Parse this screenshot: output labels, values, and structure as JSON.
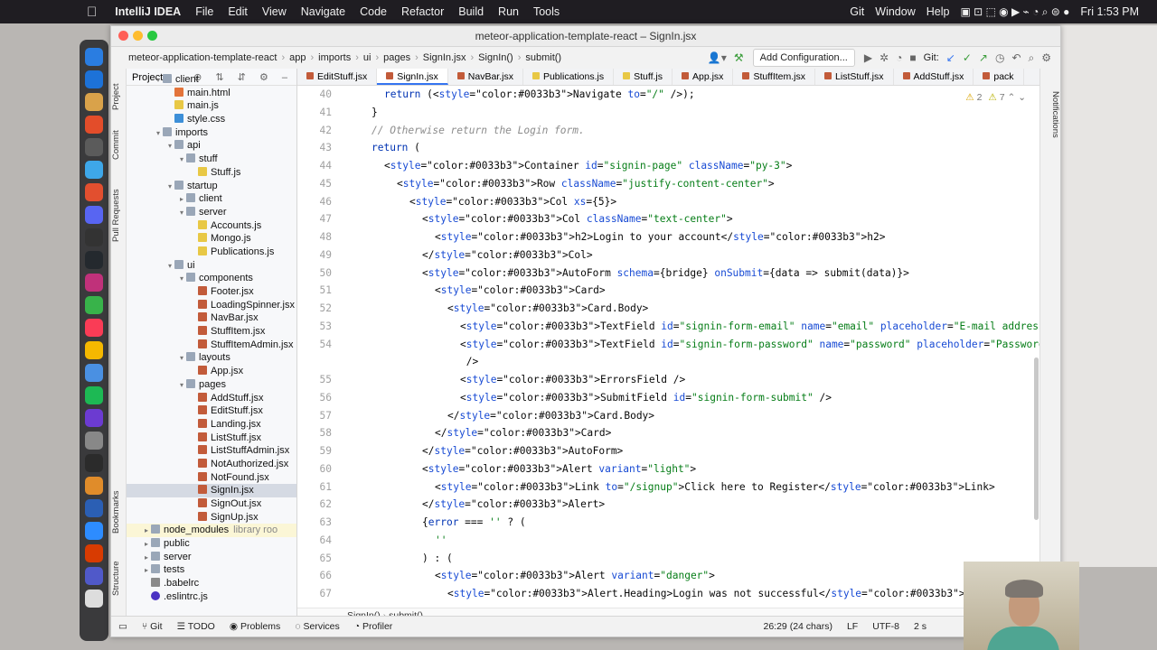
{
  "menubar": {
    "app": "IntelliJ IDEA",
    "items": [
      "File",
      "Edit",
      "View",
      "Navigate",
      "Code",
      "Refactor",
      "Build",
      "Run",
      "Tools"
    ],
    "right_items": [
      "Git",
      "Window",
      "Help"
    ],
    "clock": "Fri 1:53 PM"
  },
  "window": {
    "title": "meteor-application-template-react – SignIn.jsx"
  },
  "nav_breadcrumbs": [
    "meteor-application-template-react",
    "app",
    "imports",
    "ui",
    "pages",
    "SignIn.jsx",
    "SignIn()",
    "submit()"
  ],
  "toolbar": {
    "add_config": "Add Configuration...",
    "git_label": "Git:"
  },
  "side_tabs": {
    "project": "Project",
    "commit": "Commit",
    "pull_requests": "Pull Requests",
    "bookmarks": "Bookmarks",
    "structure": "Structure",
    "notifications": "Notifications"
  },
  "project_panel": {
    "title": "Project",
    "tree": [
      {
        "label": "client",
        "depth": 2,
        "type": "folder",
        "arrow": "▾"
      },
      {
        "label": "main.html",
        "depth": 3,
        "type": "file-html"
      },
      {
        "label": "main.js",
        "depth": 3,
        "type": "file-js"
      },
      {
        "label": "style.css",
        "depth": 3,
        "type": "file-css"
      },
      {
        "label": "imports",
        "depth": 2,
        "type": "folder",
        "arrow": "▾"
      },
      {
        "label": "api",
        "depth": 3,
        "type": "folder",
        "arrow": "▾"
      },
      {
        "label": "stuff",
        "depth": 4,
        "type": "folder",
        "arrow": "▾"
      },
      {
        "label": "Stuff.js",
        "depth": 5,
        "type": "file-js"
      },
      {
        "label": "startup",
        "depth": 3,
        "type": "folder",
        "arrow": "▾"
      },
      {
        "label": "client",
        "depth": 4,
        "type": "folder",
        "arrow": "▸"
      },
      {
        "label": "server",
        "depth": 4,
        "type": "folder",
        "arrow": "▾"
      },
      {
        "label": "Accounts.js",
        "depth": 5,
        "type": "file-js"
      },
      {
        "label": "Mongo.js",
        "depth": 5,
        "type": "file-js"
      },
      {
        "label": "Publications.js",
        "depth": 5,
        "type": "file-js"
      },
      {
        "label": "ui",
        "depth": 3,
        "type": "folder",
        "arrow": "▾"
      },
      {
        "label": "components",
        "depth": 4,
        "type": "folder",
        "arrow": "▾"
      },
      {
        "label": "Footer.jsx",
        "depth": 5,
        "type": "file-jsx"
      },
      {
        "label": "LoadingSpinner.jsx",
        "depth": 5,
        "type": "file-jsx"
      },
      {
        "label": "NavBar.jsx",
        "depth": 5,
        "type": "file-jsx"
      },
      {
        "label": "StuffItem.jsx",
        "depth": 5,
        "type": "file-jsx"
      },
      {
        "label": "StuffItemAdmin.jsx",
        "depth": 5,
        "type": "file-jsx"
      },
      {
        "label": "layouts",
        "depth": 4,
        "type": "folder",
        "arrow": "▾"
      },
      {
        "label": "App.jsx",
        "depth": 5,
        "type": "file-jsx"
      },
      {
        "label": "pages",
        "depth": 4,
        "type": "folder",
        "arrow": "▾"
      },
      {
        "label": "AddStuff.jsx",
        "depth": 5,
        "type": "file-jsx"
      },
      {
        "label": "EditStuff.jsx",
        "depth": 5,
        "type": "file-jsx"
      },
      {
        "label": "Landing.jsx",
        "depth": 5,
        "type": "file-jsx"
      },
      {
        "label": "ListStuff.jsx",
        "depth": 5,
        "type": "file-jsx"
      },
      {
        "label": "ListStuffAdmin.jsx",
        "depth": 5,
        "type": "file-jsx"
      },
      {
        "label": "NotAuthorized.jsx",
        "depth": 5,
        "type": "file-jsx"
      },
      {
        "label": "NotFound.jsx",
        "depth": 5,
        "type": "file-jsx"
      },
      {
        "label": "SignIn.jsx",
        "depth": 5,
        "type": "file-jsx",
        "selected": true
      },
      {
        "label": "SignOut.jsx",
        "depth": 5,
        "type": "file-jsx"
      },
      {
        "label": "SignUp.jsx",
        "depth": 5,
        "type": "file-jsx"
      },
      {
        "label": "node_modules",
        "depth": 1,
        "type": "folder",
        "arrow": "▸",
        "note": "library roo",
        "lib": true
      },
      {
        "label": "public",
        "depth": 1,
        "type": "folder",
        "arrow": "▸"
      },
      {
        "label": "server",
        "depth": 1,
        "type": "folder",
        "arrow": "▸"
      },
      {
        "label": "tests",
        "depth": 1,
        "type": "folder",
        "arrow": "▸"
      },
      {
        "label": ".babelrc",
        "depth": 1,
        "type": "file-rc"
      },
      {
        "label": ".eslintrc.js",
        "depth": 1,
        "type": "file-eslint"
      }
    ]
  },
  "editor_tabs": [
    "EditStuff.jsx",
    "SignIn.jsx",
    "NavBar.jsx",
    "Publications.js",
    "Stuff.js",
    "App.jsx",
    "StuffItem.jsx",
    "ListStuff.jsx",
    "AddStuff.jsx",
    "pack"
  ],
  "active_tab": "SignIn.jsx",
  "inspection": {
    "warnings": "2",
    "weak": "7"
  },
  "code_lines": [
    {
      "n": "40",
      "indent": 2,
      "text": "return (<Navigate to=\"/\" />);"
    },
    {
      "n": "41",
      "indent": 1,
      "text": "}"
    },
    {
      "n": "42",
      "indent": 1,
      "text": "// Otherwise return the Login form.",
      "comment": true
    },
    {
      "n": "43",
      "indent": 1,
      "text": "return ("
    },
    {
      "n": "44",
      "indent": 2,
      "text": "<Container id=\"signin-page\" className=\"py-3\">"
    },
    {
      "n": "45",
      "indent": 3,
      "text": "<Row className=\"justify-content-center\">"
    },
    {
      "n": "46",
      "indent": 4,
      "text": "<Col xs={5}>"
    },
    {
      "n": "47",
      "indent": 5,
      "text": "<Col className=\"text-center\">"
    },
    {
      "n": "48",
      "indent": 6,
      "text": "<h2>Login to your account</h2>"
    },
    {
      "n": "49",
      "indent": 5,
      "text": "</Col>"
    },
    {
      "n": "50",
      "indent": 5,
      "text": "<AutoForm schema={bridge} onSubmit={data => submit(data)}>"
    },
    {
      "n": "51",
      "indent": 6,
      "text": "<Card>"
    },
    {
      "n": "52",
      "indent": 7,
      "text": "<Card.Body>"
    },
    {
      "n": "53",
      "indent": 8,
      "text": "<TextField id=\"signin-form-email\" name=\"email\" placeholder=\"E-mail address\" />"
    },
    {
      "n": "54",
      "indent": 8,
      "text": "<TextField id=\"signin-form-password\" name=\"password\" placeholder=\"Password\" type=\"password\""
    },
    {
      "n": "",
      "indent": 8,
      "text": " />"
    },
    {
      "n": "55",
      "indent": 8,
      "text": "<ErrorsField />"
    },
    {
      "n": "56",
      "indent": 8,
      "text": "<SubmitField id=\"signin-form-submit\" />"
    },
    {
      "n": "57",
      "indent": 7,
      "text": "</Card.Body>"
    },
    {
      "n": "58",
      "indent": 6,
      "text": "</Card>"
    },
    {
      "n": "59",
      "indent": 5,
      "text": "</AutoForm>"
    },
    {
      "n": "60",
      "indent": 5,
      "text": "<Alert variant=\"light\">"
    },
    {
      "n": "61",
      "indent": 6,
      "text": "<Link to=\"/signup\">Click here to Register</Link>"
    },
    {
      "n": "62",
      "indent": 5,
      "text": "</Alert>"
    },
    {
      "n": "63",
      "indent": 5,
      "text": "{error === '' ? ("
    },
    {
      "n": "64",
      "indent": 6,
      "text": "''"
    },
    {
      "n": "65",
      "indent": 5,
      "text": ") : ("
    },
    {
      "n": "66",
      "indent": 6,
      "text": "<Alert variant=\"danger\">"
    },
    {
      "n": "67",
      "indent": 7,
      "text": "<Alert.Heading>Login was not successful</Alert.Heading>"
    }
  ],
  "editor_breadcrumb": [
    "SignIn()",
    "submit()"
  ],
  "statusbar": {
    "left": [
      "Git",
      "TODO",
      "Problems",
      "Services",
      "Profiler"
    ],
    "position": "26:29 (24 chars)",
    "line_sep": "LF",
    "encoding": "UTF-8",
    "indent": "2 s"
  },
  "colors": {
    "keyword": "#0033b3",
    "tag": "#0033b3",
    "attr": "#174ad4",
    "string": "#067d17",
    "comment": "#8c8c8c",
    "accent": "#3574f0"
  }
}
